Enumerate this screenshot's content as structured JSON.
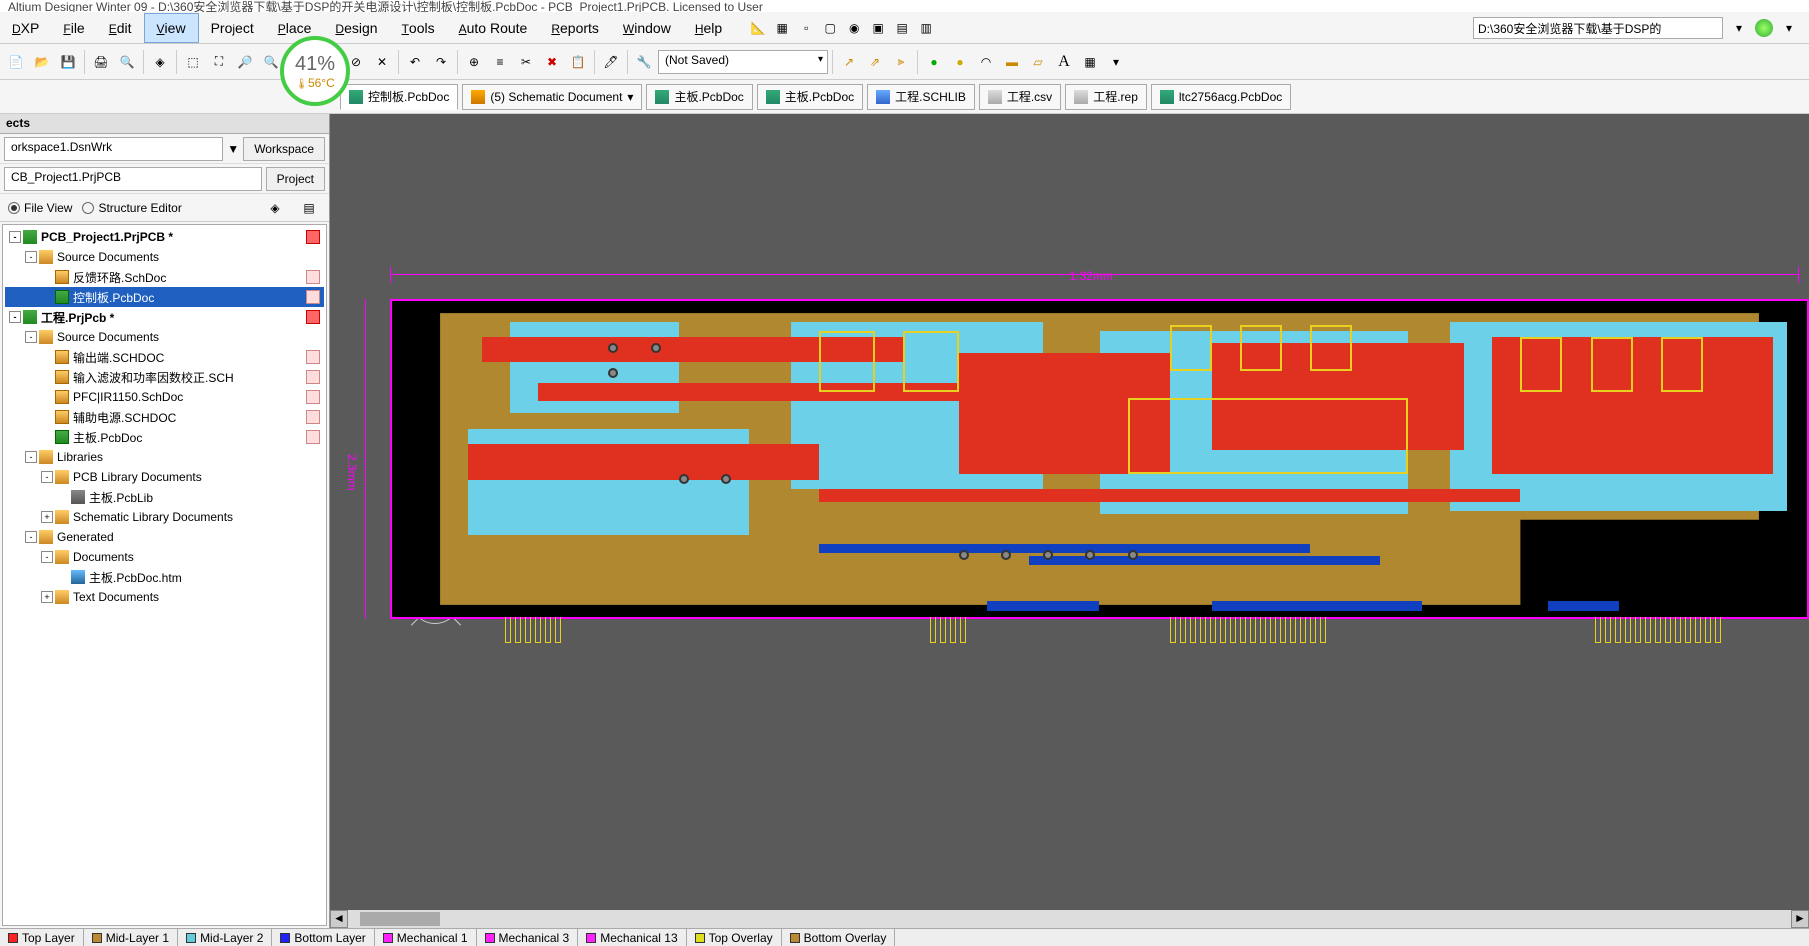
{
  "title_bar": "Altium Designer Winter 09 - D:\\360安全浏览器下载\\基于DSP的开关电源设计\\控制板\\控制板.PcbDoc - PCB_Project1.PrjPCB. Licensed to User",
  "menu": {
    "dxp": "DXP",
    "file": "File",
    "edit": "Edit",
    "view": "View",
    "project": "Project",
    "place": "Place",
    "design": "Design",
    "tools": "Tools",
    "autoroute": "Auto Route",
    "reports": "Reports",
    "window": "Window",
    "help": "Help",
    "path": "D:\\360安全浏览器下载\\基于DSP的"
  },
  "cpu": {
    "pct": "41%",
    "temp": "56°C"
  },
  "toolbar": {
    "combo": "(Not Saved)"
  },
  "doc_tabs": [
    {
      "label": "控制板.PcbDoc",
      "icon": "ic-pcb"
    },
    {
      "label": "(5) Schematic Document",
      "icon": "ic-sch"
    },
    {
      "label": "主板.PcbDoc",
      "icon": "ic-pcb"
    },
    {
      "label": "主板.PcbDoc",
      "icon": "ic-pcb"
    },
    {
      "label": "工程.SCHLIB",
      "icon": "ic-lib"
    },
    {
      "label": "工程.csv",
      "icon": "ic-csv"
    },
    {
      "label": "工程.rep",
      "icon": "ic-csv"
    },
    {
      "label": "ltc2756acg.PcbDoc",
      "icon": "ic-pcb"
    }
  ],
  "panel": {
    "header": "ects",
    "workspace_val": "orkspace1.DsnWrk",
    "workspace_btn": "Workspace",
    "project_val": "CB_Project1.PrjPCB",
    "project_btn": "Project",
    "file_view": "File View",
    "structure_editor": "Structure Editor"
  },
  "tree": [
    {
      "d": 0,
      "exp": "-",
      "ic": "ic-proj",
      "t": "PCB_Project1.PrjPCB *",
      "cls": "project",
      "badge": "badge-red"
    },
    {
      "d": 1,
      "exp": "-",
      "ic": "ic-fold",
      "t": "Source Documents"
    },
    {
      "d": 2,
      "ic": "ic-schd",
      "t": "反馈环路.SchDoc",
      "badge": "badge-doc"
    },
    {
      "d": 2,
      "ic": "ic-pcbd",
      "t": "控制板.PcbDoc",
      "sel": true,
      "badge": "badge-doc"
    },
    {
      "d": 0,
      "exp": "-",
      "ic": "ic-proj",
      "t": "工程.PrjPcb *",
      "cls": "project",
      "badge": "badge-red"
    },
    {
      "d": 1,
      "exp": "-",
      "ic": "ic-fold",
      "t": "Source Documents"
    },
    {
      "d": 2,
      "ic": "ic-schd",
      "t": "输出端.SCHDOC",
      "badge": "badge-doc"
    },
    {
      "d": 2,
      "ic": "ic-schd",
      "t": "输入滤波和功率因数校正.SCH",
      "badge": "badge-doc"
    },
    {
      "d": 2,
      "ic": "ic-schd",
      "t": "PFC|IR1150.SchDoc",
      "badge": "badge-doc"
    },
    {
      "d": 2,
      "ic": "ic-schd",
      "t": "辅助电源.SCHDOC",
      "badge": "badge-doc"
    },
    {
      "d": 2,
      "ic": "ic-pcbd",
      "t": "主板.PcbDoc",
      "badge": "badge-doc"
    },
    {
      "d": 1,
      "exp": "-",
      "ic": "ic-fold",
      "t": "Libraries"
    },
    {
      "d": 2,
      "exp": "-",
      "ic": "ic-fold",
      "t": "PCB Library Documents"
    },
    {
      "d": 3,
      "ic": "ic-libd",
      "t": "主板.PcbLib"
    },
    {
      "d": 2,
      "exp": "+",
      "ic": "ic-fold",
      "t": "Schematic Library Documents"
    },
    {
      "d": 1,
      "exp": "-",
      "ic": "ic-fold",
      "t": "Generated"
    },
    {
      "d": 2,
      "exp": "-",
      "ic": "ic-fold",
      "t": "Documents"
    },
    {
      "d": 3,
      "ic": "ic-htm",
      "t": "主板.PcbDoc.htm"
    },
    {
      "d": 2,
      "exp": "+",
      "ic": "ic-fold",
      "t": "Text Documents"
    }
  ],
  "dims": {
    "h": "1.32mm",
    "v": "2.3mm"
  },
  "layer_tabs": [
    {
      "c": "#f22",
      "t": "Top Layer"
    },
    {
      "c": "#b83",
      "t": "Mid-Layer 1"
    },
    {
      "c": "#6cd",
      "t": "Mid-Layer 2"
    },
    {
      "c": "#22f",
      "t": "Bottom Layer"
    },
    {
      "c": "#f2f",
      "t": "Mechanical 1"
    },
    {
      "c": "#f2f",
      "t": "Mechanical 3"
    },
    {
      "c": "#f2f",
      "t": "Mechanical 13"
    },
    {
      "c": "#dd2",
      "t": "Top Overlay"
    },
    {
      "c": "#b83",
      "t": "Bottom Overlay"
    }
  ]
}
